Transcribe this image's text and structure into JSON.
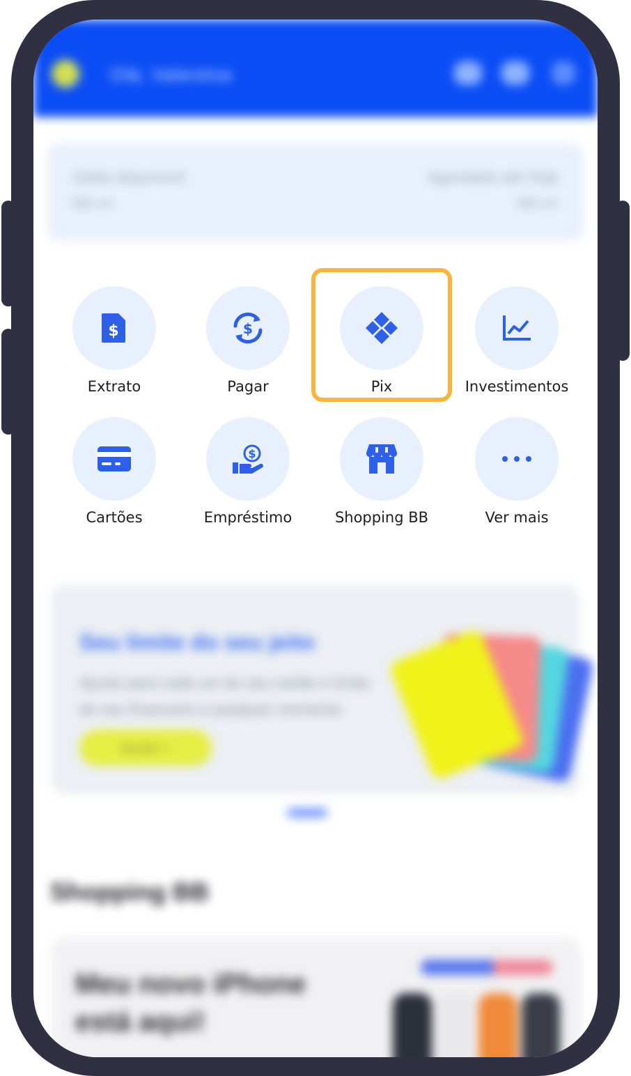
{
  "header": {
    "greeting": "Olá, Valentina",
    "icons": [
      "eye-icon",
      "chat-icon",
      "logout-icon"
    ]
  },
  "balance": {
    "left_label": "Saldo disponível",
    "left_value": "R$ ••••",
    "right_label": "Agendado até Hoje",
    "right_value": "R$ ••••"
  },
  "quick_actions": [
    {
      "label": "Extrato",
      "icon": "statement-icon"
    },
    {
      "label": "Pagar",
      "icon": "pay-icon"
    },
    {
      "label": "Pix",
      "icon": "pix-icon"
    },
    {
      "label": "Investimentos",
      "icon": "investments-icon"
    },
    {
      "label": "Cartões",
      "icon": "card-icon"
    },
    {
      "label": "Empréstimo",
      "icon": "loan-icon"
    },
    {
      "label": "Shopping BB",
      "icon": "store-icon"
    },
    {
      "label": "Ver mais",
      "icon": "more-icon"
    }
  ],
  "highlighted_action": "Pix",
  "banner": {
    "title": "Seu limite do seu jeito",
    "text": "Ajuste para cada um do seu cartão o limite de seu financeiro a qualquer momento.",
    "button": "Ajustar >"
  },
  "shopping": {
    "section_title": "Shopping BB",
    "promo_title": "Meu novo iPhone está aqui!"
  },
  "colors": {
    "brand_blue": "#0b4df5",
    "icon_blue": "#2e5fe8",
    "icon_bg": "#e8f0fe",
    "highlight": "#fbb43b",
    "frame": "#303042"
  }
}
